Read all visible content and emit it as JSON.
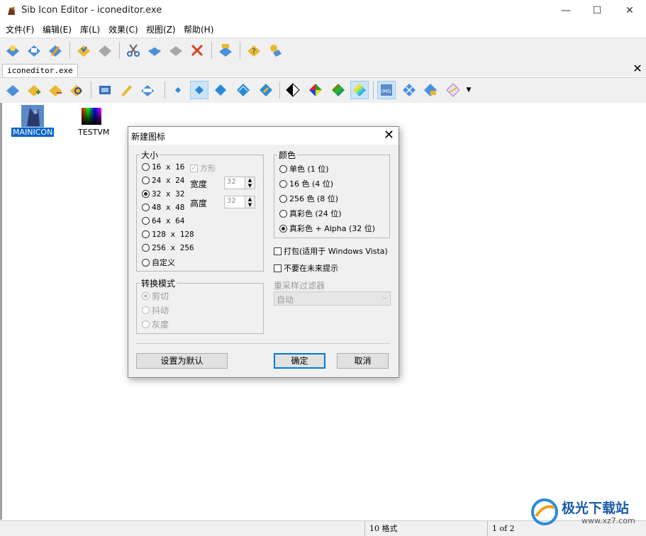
{
  "window": {
    "title": "Sib Icon Editor - iconeditor.exe",
    "minimize_glyph": "—",
    "maximize_glyph": "☐",
    "close_glyph": "✕"
  },
  "menu": [
    "文件(F)",
    "编辑(E)",
    "库(L)",
    "效果(C)",
    "视图(Z)",
    "帮助(H)"
  ],
  "toolbar1_icons": [
    "new-icon",
    "open-icon",
    "wizard-icon",
    "save-icon",
    "save-disabled-icon",
    "cut-icon",
    "copy-icon",
    "paste-icon",
    "delete-icon",
    "import-icon",
    "help-icon",
    "about-icon"
  ],
  "tab": {
    "label": "iconeditor.exe",
    "close_glyph": "✕"
  },
  "toolbar2_icons": [
    "icon-view-icon",
    "add-image-icon",
    "remove-image-icon",
    "search-image-icon",
    "film-icon",
    "pen-icon",
    "resources-icon",
    "size-16-icon",
    "size-32-icon",
    "size-48-icon",
    "size-64-icon",
    "size-256-icon",
    "mono-color-icon",
    "16-color-icon",
    "256-color-icon",
    "true-color-icon",
    "truecolor-alpha-icon",
    "image-format-icon",
    "export-icon",
    "import-image-icon",
    "properties-icon",
    "more-dropdown-icon"
  ],
  "canvas_icons": [
    {
      "label": "MAINICON",
      "selected": true
    },
    {
      "label": "TESTVM",
      "selected": false
    }
  ],
  "status": {
    "formats": "10 格式",
    "page": "1 of 2"
  },
  "dialog": {
    "title": "新建图标",
    "close_glyph": "✕",
    "size_group": "大小",
    "sizes": [
      "16 x 16",
      "24 x 24",
      "32 x 32",
      "48 x 48",
      "64 x 64",
      "128 x 128",
      "256 x 256",
      "自定义"
    ],
    "size_selected": "32 x 32",
    "square_label": "方形",
    "width_label": "宽度",
    "height_label": "高度",
    "width_value": "32",
    "height_value": "32",
    "convert_group": "转换模式",
    "convert_modes": [
      "剪切",
      "抖动",
      "灰度"
    ],
    "color_group": "颜色",
    "colors": [
      "单色 (1 位)",
      "16 色 (4 位)",
      "256 色 (8 位)",
      "真彩色 (24 位)",
      "真彩色 + Alpha (32 位)"
    ],
    "color_selected": "真彩色 + Alpha (32 位)",
    "pack_label": "打包(适用于 Windows Vista)",
    "no_prompt_label": "不要在未来提示",
    "resample_label": "重采样过滤器",
    "resample_value": "自动",
    "set_default_button": "设置为默认",
    "ok_button": "确定",
    "cancel_button": "取消"
  },
  "watermark": {
    "text": "极光下载站",
    "url": "www.xz7.com"
  }
}
